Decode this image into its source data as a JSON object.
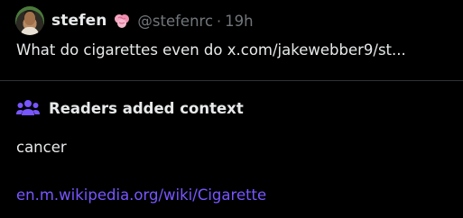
{
  "tweet": {
    "display_name": "stefen",
    "handle": "@stefenrc",
    "separator": "·",
    "time": "19h",
    "badge_icon": "pink-brain-icon",
    "text": "What do cigarettes even do x.com/jakewebber9/st..."
  },
  "context": {
    "icon": "people-group-icon",
    "title": "Readers added context",
    "body": "cancer",
    "link": "en.m.wikipedia.org/wiki/Cigarette"
  },
  "colors": {
    "background": "#000000",
    "text_primary": "#e7e9ea",
    "text_secondary": "#71767b",
    "accent": "#7856ff",
    "divider": "#2f3336"
  }
}
